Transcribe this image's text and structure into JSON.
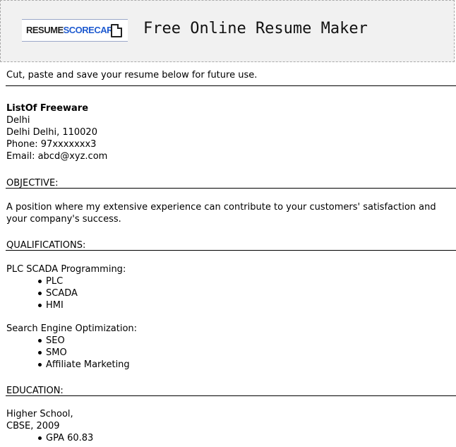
{
  "header": {
    "logo_text_a": "RESUME",
    "logo_text_b": "SCORECARD",
    "title": "Free Online Resume Maker"
  },
  "intro": "Cut, paste and save your resume below for future use.",
  "contact": {
    "name": "ListOf Freeware",
    "line1": "Delhi",
    "line2": "Delhi Delhi, 110020",
    "phone": "Phone: 97xxxxxxx3",
    "email": "Email: abcd@xyz.com"
  },
  "objective": {
    "heading": "OBJECTIVE:",
    "text": "A position where my extensive experience can contribute to your customers' satisfaction and your company's success."
  },
  "qualifications": {
    "heading": "QUALIFICATIONS:",
    "groups": [
      {
        "title": "PLC SCADA Programming:",
        "items": [
          "PLC",
          "SCADA",
          "HMI"
        ]
      },
      {
        "title": "Search Engine Optimization:",
        "items": [
          "SEO",
          "SMO",
          "Affiliate Marketing"
        ]
      }
    ]
  },
  "education": {
    "heading": "EDUCATION:",
    "school": "Higher School,",
    "board": "CBSE, 2009",
    "items": [
      "GPA 60.83"
    ]
  }
}
